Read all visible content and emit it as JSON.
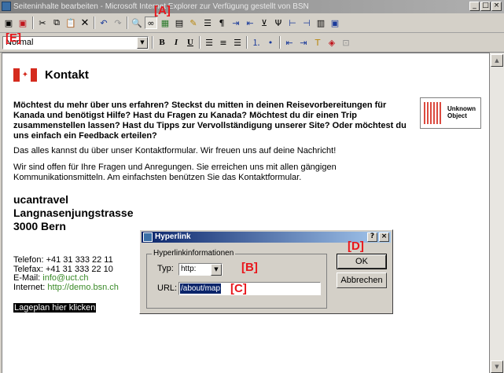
{
  "window": {
    "title": "Seiteninhalte bearbeiten - Microsoft Internet Explorer zur Verfügung gestellt von BSN",
    "minimize": "_",
    "maximize": "□",
    "close": "×"
  },
  "markers": {
    "A": "[A]",
    "B": "[B]",
    "C": "[C]",
    "D": "[D]",
    "E": "[E]"
  },
  "toolbar": {
    "icons": [
      "save-icon",
      "save-as-icon",
      "cut-icon",
      "copy-icon",
      "paste-icon",
      "delete-icon",
      "undo-icon",
      "redo-icon",
      "find-icon",
      "hyperlink-icon",
      "image-icon",
      "table-icon",
      "highlight-icon",
      "list-box-icon",
      "paragraph-icon",
      "indent-icon",
      "outdent-icon",
      "insert-row-icon",
      "insert-column-icon",
      "split-cell-icon",
      "merge-cell-icon",
      "grid-icon",
      "form-icon"
    ]
  },
  "format_bar": {
    "style_value": "Normal",
    "bold": "B",
    "italic": "I",
    "underline": "U"
  },
  "page": {
    "heading": "Kontakt",
    "intro": "Möchtest du mehr über uns erfahren? Steckst du mitten in deinen Reisevorbereitungen für Kanada und benötigst Hilfe? Hast du Fragen zu Kanada? Möchtest du dir einen Trip zusammenstellen lassen? Hast du Tipps zur Vervollständigung unserer Site? Oder möchtest du uns einfach ein Feedback erteilen?",
    "para1": "Das alles kannst du über unser Kontaktformular. Wir freuen uns auf deine Nachricht!",
    "para2": "Wir sind offen für Ihre Fragen und Anregungen. Sie erreichen uns mit allen gängigen Kommunikationsmitteln. Am einfachsten benützen Sie das Kontaktformular.",
    "unknown_object": "Unknown Object",
    "company": "ucantravel",
    "street": "Langnasenjungstrasse",
    "city": "3000 Bern",
    "phone": "Telefon: +41 31 333 22 11",
    "fax": "Telefax: +41 31 333 22 10",
    "email_label": "E-Mail:",
    "email": "info@uct.ch",
    "internet_label": "Internet:",
    "internet": "http://demo.bsn.ch",
    "lageplan": "Lageplan hier klicken"
  },
  "dialog": {
    "title": "Hyperlink",
    "help": "?",
    "close": "×",
    "group_label": "Hyperlinkinformationen",
    "type_label": "Typ:",
    "type_value": "http:",
    "url_label": "URL:",
    "url_value": "/about/map",
    "ok": "OK",
    "cancel": "Abbrechen"
  },
  "colors": {
    "link_green": "#3a8a28",
    "marker_red": "#e8161c",
    "selection": "#0a246a"
  }
}
